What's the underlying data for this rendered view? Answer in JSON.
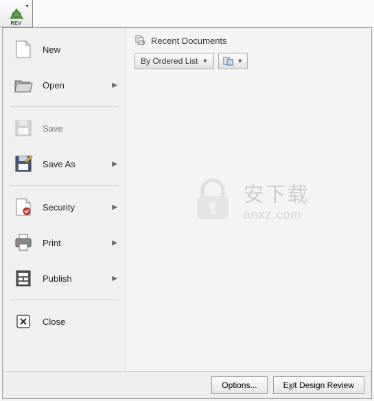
{
  "app": {
    "rev_label": "REV"
  },
  "menu": {
    "new": "New",
    "open": "Open",
    "save": "Save",
    "save_as": "Save As",
    "security": "Security",
    "print": "Print",
    "publish": "Publish",
    "close": "Close"
  },
  "recent": {
    "title": "Recent Documents",
    "sort_label": "By Ordered List"
  },
  "footer": {
    "options": "Options...",
    "exit_prefix": "E",
    "exit_underlined": "x",
    "exit_suffix": "it Design Review"
  },
  "watermark": {
    "cn": "安下载",
    "url": "anxz.com"
  }
}
